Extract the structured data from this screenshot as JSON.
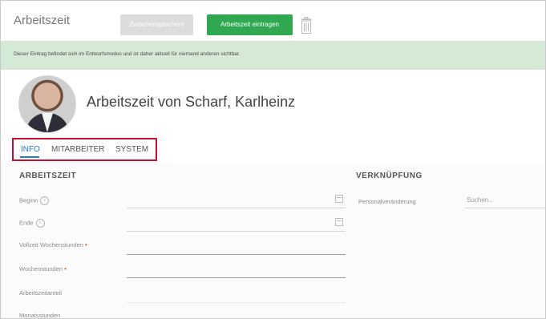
{
  "header": {
    "title": "Arbeitszeit",
    "draft_button": "Zwischenspeichern",
    "submit_button": "Arbeitszeit eintragen"
  },
  "banner": {
    "message": "Dieser Eintrag befindet sich im Entwurfsmodus und ist daher aktuell für niemand anderen sichtbar."
  },
  "profile": {
    "name": "Arbeitszeit von Scharf, Karlheinz"
  },
  "tabs": [
    {
      "label": "INFO",
      "active": true
    },
    {
      "label": "MITARBEITER",
      "active": false
    },
    {
      "label": "SYSTEM",
      "active": false
    }
  ],
  "sections": {
    "left_title": "ARBEITSZEIT",
    "right_title": "VERKNÜPFUNG"
  },
  "fields": [
    {
      "label": "Beginn",
      "has_info": true,
      "required": false,
      "value": ""
    },
    {
      "label": "Ende",
      "has_info": true,
      "required": false,
      "value": ""
    },
    {
      "label": "Vollzeit Wochenstunden",
      "has_info": false,
      "required": true,
      "value": ""
    },
    {
      "label": "Wochenstunden",
      "has_info": false,
      "required": true,
      "value": ""
    },
    {
      "label": "Arbeitszeitanteil",
      "has_info": false,
      "required": false,
      "value": ""
    },
    {
      "label": "Monatsstunden",
      "has_info": false,
      "required": false,
      "value": ""
    }
  ],
  "right_field": {
    "label": "Personalveränderung",
    "placeholder": "Suchen..."
  },
  "colors": {
    "accent_blue": "#1e7ad6",
    "submit_green": "#2fa84f",
    "banner_green": "#d5ead6",
    "highlight_red": "#c8102e",
    "required_orange": "#e24b2a"
  },
  "icons": {
    "trash": "trash-icon",
    "info": "info-icon",
    "calendar": "calendar-icon"
  },
  "info_symbol": "i",
  "required_symbol": "•"
}
